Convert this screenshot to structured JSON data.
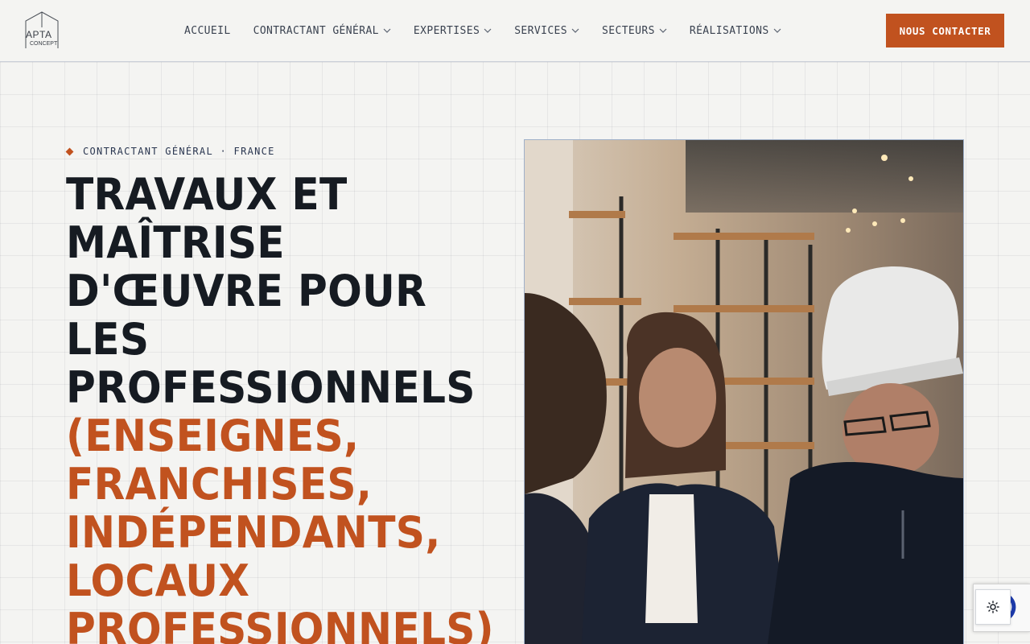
{
  "brand": {
    "name": "APTA",
    "tagline": "CONCEPT"
  },
  "nav": {
    "items": [
      {
        "label": "ACCUEIL",
        "dropdown": false
      },
      {
        "label": "CONTRACTANT GÉNÉRAL",
        "dropdown": true
      },
      {
        "label": "EXPERTISES",
        "dropdown": true
      },
      {
        "label": "SERVICES",
        "dropdown": true
      },
      {
        "label": "SECTEURS",
        "dropdown": true
      },
      {
        "label": "RÉALISATIONS",
        "dropdown": true
      }
    ],
    "cta_label": "NOUS CONTACTER"
  },
  "hero": {
    "eyebrow": "CONTRACTANT GÉNÉRAL · FRANCE",
    "title_main": "TRAVAUX ET MAÎTRISE D'ŒUVRE POUR LES PROFESSIONNELS",
    "title_accent": "(ENSEIGNES, FRANCHISES, INDÉPENDANTS, LOCAUX PROFESSIONNELS)"
  },
  "colors": {
    "accent": "#c1521f",
    "text_dark": "#161b22",
    "eyebrow_text": "#2a3650",
    "background": "#f4f4f2"
  },
  "icons": {
    "logo": "house-outline-logo",
    "nav_dropdown": "chevron-down-icon",
    "theme_toggle": "sun-icon",
    "recaptcha": "recaptcha-icon"
  }
}
